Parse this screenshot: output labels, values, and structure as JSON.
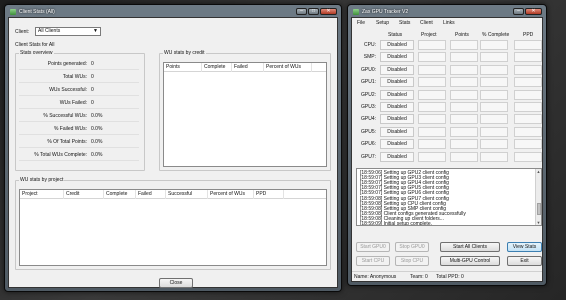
{
  "client_stats_window": {
    "title": "Client Stats (All)",
    "client_label": "Client:",
    "client_value": "All Clients",
    "header_text": "Client Stats for All",
    "stats_overview": {
      "title": "Stats overview",
      "rows": [
        {
          "key": "Points generated:",
          "value": "0"
        },
        {
          "key": "Total WUs:",
          "value": "0"
        },
        {
          "key": "WUs Successful:",
          "value": "0"
        },
        {
          "key": "WUs Failed:",
          "value": "0"
        },
        {
          "key": "% Successful WUs:",
          "value": "0.0%"
        },
        {
          "key": "% Failed WUs:",
          "value": "0.0%"
        },
        {
          "key": "% Of Total Points:",
          "value": "0.0%"
        },
        {
          "key": "% Total WUs Complete:",
          "value": "0.0%"
        }
      ]
    },
    "wu_by_credit": {
      "title": "WU stats by credit",
      "columns": [
        "Points",
        "Complete",
        "Failed",
        "Percent of WUs"
      ]
    },
    "wu_by_project": {
      "title": "WU stats by project",
      "columns": [
        "Project",
        "Credit",
        "Complete",
        "Failed",
        "Successful",
        "Percent of WUs",
        "PPD"
      ]
    },
    "close_label": "Close"
  },
  "gpu_tracker_window": {
    "title": "Zax GPU Tracker V2",
    "menu": [
      "File",
      "Setup",
      "Stats",
      "Client",
      "Links"
    ],
    "columns": [
      "Status",
      "Project",
      "Points",
      "% Complete",
      "PPD"
    ],
    "rows": [
      {
        "label": "CPU:",
        "status": "Disabled"
      },
      {
        "label": "SMP:",
        "status": "Disabled"
      },
      {
        "label": "GPU0:",
        "status": "Disabled"
      },
      {
        "label": "GPU1:",
        "status": "Disabled"
      },
      {
        "label": "GPU2:",
        "status": "Disabled"
      },
      {
        "label": "GPU3:",
        "status": "Disabled"
      },
      {
        "label": "GPU4:",
        "status": "Disabled"
      },
      {
        "label": "GPU5:",
        "status": "Disabled"
      },
      {
        "label": "GPU6:",
        "status": "Disabled"
      },
      {
        "label": "GPU7:",
        "status": "Disabled"
      }
    ],
    "log": [
      "[18:59:06] Setting up GPU2 client config",
      "[18:59:07] Setting up GPU3 client config",
      "[18:59:07] Setting up GPU4 client config",
      "[18:59:07] Setting up GPU5 client config",
      "[18:59:07] Setting up GPU6 client config",
      "[18:59:08] Setting up GPU7 client config",
      "[18:59:08] Setting up CPU client config",
      "[18:59:08] Setting up SMP client config",
      "[18:59:08] Client configs generated successfully",
      "[18:59:08] Cleaning up client folders...",
      "[18:59:09] Initial setup complete."
    ],
    "buttons": {
      "start_gpu0": "Start GPU0",
      "stop_gpu0": "Stop GPU0",
      "start_cpu": "Start CPU",
      "stop_cpu": "Stop CPU",
      "start_all": "Start All Clients",
      "multi_gpu": "Multi-GPU Control",
      "view_stats": "View Stats",
      "exit": "Exit"
    },
    "status": {
      "name": "Name: Anonymous",
      "team": "Team: 0",
      "ppd": "Total PPD: 0"
    }
  }
}
